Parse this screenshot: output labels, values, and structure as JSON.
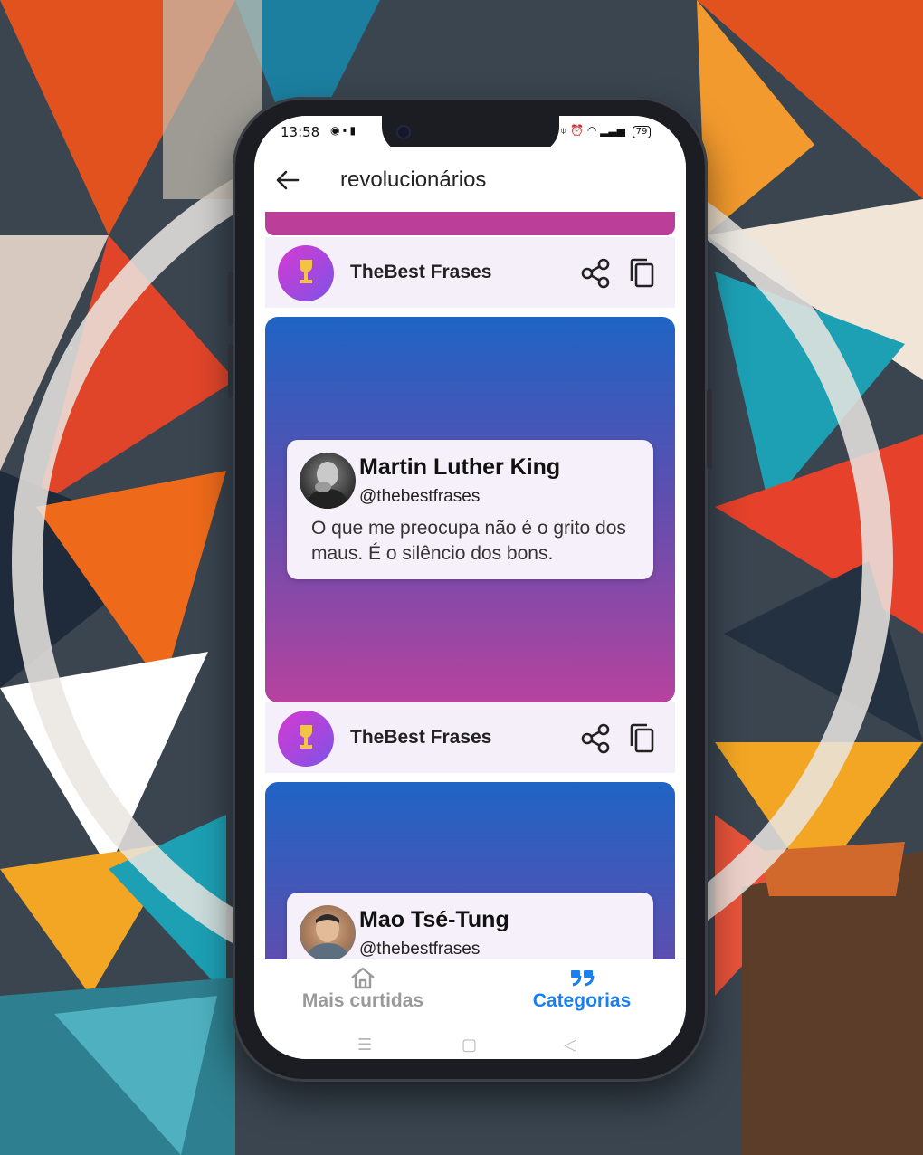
{
  "status_bar": {
    "time": "13:58",
    "battery": "79"
  },
  "app_bar": {
    "title": "revolucionários"
  },
  "brand": {
    "name": "TheBest Frases"
  },
  "quotes": [
    {
      "author": "Martin Luther King",
      "handle": "@thebestfrases",
      "text": "O que me preocupa não é o grito dos maus. É o silêncio dos bons."
    },
    {
      "author": "Mao Tsé-Tung",
      "handle": "@thebestfrases",
      "text": ""
    }
  ],
  "bottom_nav": {
    "items": [
      {
        "label": "Mais curtidas",
        "icon": "home-icon",
        "active": false
      },
      {
        "label": "Categorias",
        "icon": "quote-icon",
        "active": true
      }
    ]
  },
  "colors": {
    "accent": "#1a7ff0",
    "inactive": "#9a9a9a",
    "card_gradient_top": "#1f64c4",
    "card_gradient_bottom": "#b6439e",
    "author_row_bg": "#f4eff9"
  }
}
